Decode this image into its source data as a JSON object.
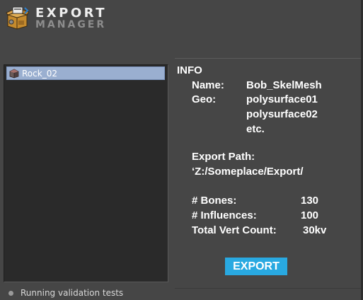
{
  "app": {
    "logo_line1": "EXPORT",
    "logo_line2": "MANAGER"
  },
  "asset_list": {
    "items": [
      {
        "label": "Rock_02",
        "icon": "cube-icon",
        "selected": true
      }
    ]
  },
  "status": {
    "text": "Running validation tests"
  },
  "info": {
    "heading": "INFO",
    "name_label": "Name:",
    "name_value": "Bob_SkelMesh",
    "geo_label": "Geo:",
    "geo_values": [
      "polysurface01",
      "polysurface02",
      "etc."
    ],
    "export_path_label": "Export Path:",
    "export_path_value": "‘Z:/Someplace/Export/",
    "bones_label": "# Bones:",
    "bones_value": "130",
    "influences_label": "# Influences:",
    "influences_value": "100",
    "vert_label": "Total Vert Count:",
    "vert_value": "30kv"
  },
  "actions": {
    "export_label": "EXPORT"
  },
  "colors": {
    "background": "#464646",
    "list_background": "#2a2a2a",
    "selection": "#9aafd0",
    "accent": "#29a9e1"
  }
}
